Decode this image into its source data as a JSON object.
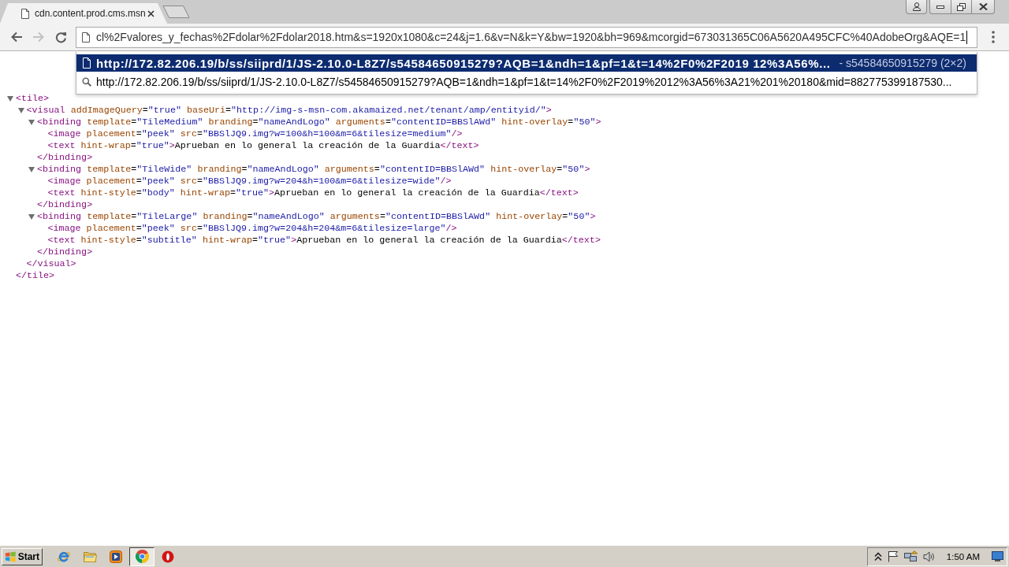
{
  "tabs": [
    {
      "title": "cdn.content.prod.cms.msn",
      "selected": true
    }
  ],
  "toolbar": {
    "buttons": [
      {
        "kind": "back",
        "disabled": false
      },
      {
        "kind": "forward",
        "disabled": true
      },
      {
        "kind": "reload",
        "disabled": false
      }
    ]
  },
  "address_bar": {
    "value": "cl%2Fvalores_y_fechas%2Fdolar%2Fdolar2018.htm&s=1920x1080&c=24&j=1.6&v=N&k=Y&bw=1920&bh=969&mcorgid=673031365C06A5620A495CFC%40AdobeOrg&AQE=1"
  },
  "suggestions": [
    {
      "kind": "page",
      "text": "http://172.82.206.19/b/ss/siiprd/1/JS-2.10.0-L8Z7/s54584650915279?AQB=1&ndh=1&pf=1&t=14%2F0%2F2019 12%3A56%...",
      "description": "- s54584650915279 (2×2)",
      "selected": true
    },
    {
      "kind": "search",
      "text": "http://172.82.206.19/b/ss/siiprd/1/JS-2.10.0-L8Z7/s54584650915279?AQB=1&ndh=1&pf=1&t=14%2F0%2F2019%2012%3A56%3A21%201%20180&mid=882775399187530...",
      "selected": false
    }
  ],
  "xml_tree": [
    {
      "kind": "node",
      "open": "<tile>",
      "close": "</tile>",
      "expanded": true,
      "children": [
        {
          "kind": "node",
          "open": "<visual addImageQuery=\"true\" baseUri=\"http://img-s-msn-com.akamaized.net/tenant/amp/entityid/\">",
          "close": "</visual>",
          "expanded": true,
          "children": [
            {
              "kind": "node",
              "open": "<binding template=\"TileMedium\" branding=\"nameAndLogo\" arguments=\"contentID=BBSlAWd\" hint-overlay=\"50\">",
              "close": "</binding>",
              "expanded": true,
              "children": [
                {
                  "kind": "line",
                  "line": "<image placement=\"peek\" src=\"BBSlJQ9.img?w=100&h=100&m=6&tilesize=medium\"/>"
                },
                {
                  "kind": "line",
                  "line": "<text hint-wrap=\"true\">Aprueban en lo general la creación de la Guardia</text>"
                }
              ]
            },
            {
              "kind": "node",
              "open": "<binding template=\"TileWide\" branding=\"nameAndLogo\" arguments=\"contentID=BBSlAWd\" hint-overlay=\"50\">",
              "close": "</binding>",
              "expanded": true,
              "children": [
                {
                  "kind": "line",
                  "line": "<image placement=\"peek\" src=\"BBSlJQ9.img?w=204&h=100&m=6&tilesize=wide\"/>"
                },
                {
                  "kind": "line",
                  "line": "<text hint-style=\"body\" hint-wrap=\"true\">Aprueban en lo general la creación de la Guardia</text>"
                }
              ]
            },
            {
              "kind": "node",
              "open": "<binding template=\"TileLarge\" branding=\"nameAndLogo\" arguments=\"contentID=BBSlAWd\" hint-overlay=\"50\">",
              "close": "</binding>",
              "expanded": true,
              "children": [
                {
                  "kind": "line",
                  "line": "<image placement=\"peek\" src=\"BBSlJQ9.img?w=204&h=204&m=6&tilesize=large\"/>"
                },
                {
                  "kind": "line",
                  "line": "<text hint-style=\"subtitle\" hint-wrap=\"true\">Aprueban en lo general la creación de la Guardia</text>"
                }
              ]
            }
          ]
        }
      ]
    }
  ],
  "taskbar": {
    "start_label": "Start",
    "apps": [
      {
        "kind": "ie",
        "selected": false
      },
      {
        "kind": "folder",
        "selected": false
      },
      {
        "kind": "media",
        "selected": false
      },
      {
        "kind": "chrome",
        "selected": true
      },
      {
        "kind": "stop",
        "selected": false
      }
    ],
    "time": "1:50 AM"
  }
}
